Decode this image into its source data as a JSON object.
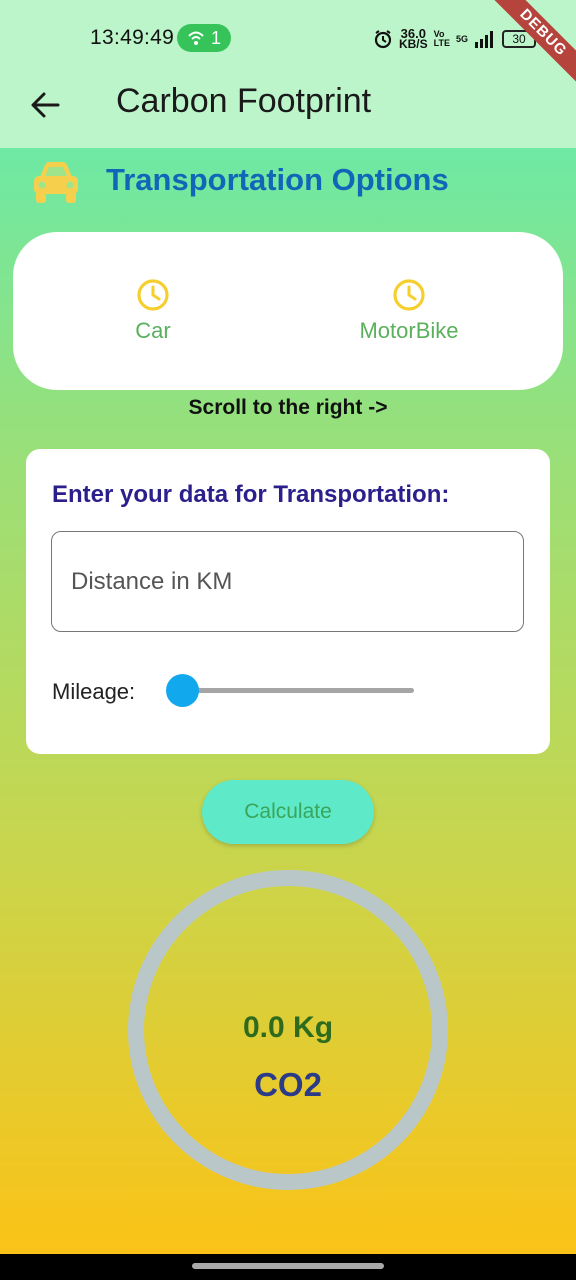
{
  "status_bar": {
    "time": "13:49:49",
    "hotspot_count": "1",
    "net_speed_value": "36.0",
    "net_speed_unit": "KB/S",
    "vo_tag": "Vo",
    "lte_tag": "LTE",
    "network_tag": "5G",
    "battery": "30",
    "debug_banner": "DEBUG"
  },
  "app_bar": {
    "title": "Carbon Footprint",
    "back_icon": "arrow-left-icon"
  },
  "section": {
    "title": "Transportation Options",
    "icon": "car-icon",
    "icon_color": "#f6d04d",
    "title_color": "#1266b8"
  },
  "options": [
    {
      "label": "Car",
      "icon": "clock-icon"
    },
    {
      "label": "MotorBike",
      "icon": "clock-icon"
    }
  ],
  "scroll_hint": "Scroll to the right ->",
  "data_entry": {
    "title": "Enter your data for Transportation:",
    "distance_placeholder": "Distance in KM",
    "mileage_label": "Mileage:",
    "mileage_value_fraction": 0
  },
  "calculate_button": "Calculate",
  "result": {
    "value": "0.0 Kg",
    "unit": "CO2"
  },
  "colors": {
    "accent": "#12a8ee",
    "button": "#5eeac9",
    "gradient_top": "#6ee9a4",
    "gradient_bottom": "#fbc317"
  }
}
